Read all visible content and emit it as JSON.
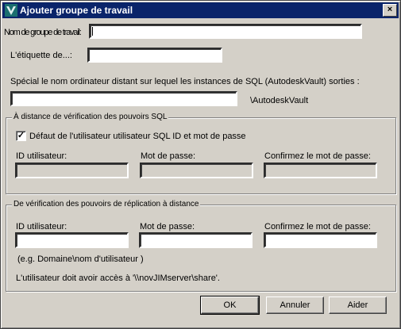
{
  "window": {
    "title": "Ajouter groupe de travail",
    "close_label": "×",
    "icon": "autodesk-vault-icon"
  },
  "fields": {
    "group_name_label": "Nom de groupe de travail:",
    "group_name_value": "",
    "tag_label": "L'étiquette de...:",
    "tag_value": "",
    "remote_desc": "Spécial le nom ordinateur distant sur lequel les instances de SQL (AutodeskVault) sorties :",
    "remote_value": "",
    "remote_suffix": "\\AutodeskVault"
  },
  "sql_group": {
    "title": "À distance de vérification des pouvoirs SQL",
    "checkbox_label": "Défaut de l'utilisateur utilisateur SQL ID et mot de passe",
    "checkbox_checked": "✓",
    "user_id_label": "ID utilisateur:",
    "password_label": "Mot de passe:",
    "confirm_label": "Confirmez le mot de passe:"
  },
  "repl_group": {
    "title": "De vérification des pouvoirs de réplication à distance",
    "user_id_label": "ID utilisateur:",
    "password_label": "Mot de passe:",
    "confirm_label": "Confirmez le mot de passe:",
    "hint": "(e.g. Domaine\\nom d'utilisateur )",
    "access_note": "L'utilisateur doit avoir accès à '\\\\novJIMserver\\share'."
  },
  "buttons": {
    "ok": "OK",
    "cancel": "Annuler",
    "help": "Aider"
  }
}
